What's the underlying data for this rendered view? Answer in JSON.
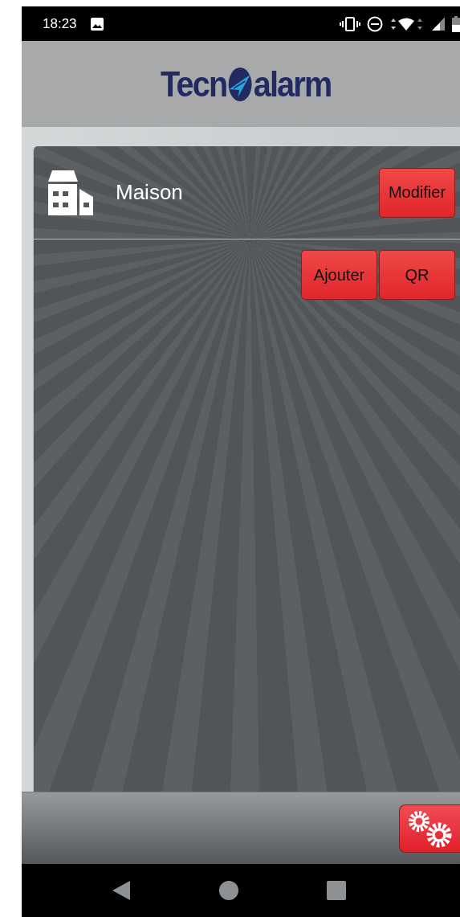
{
  "status_bar": {
    "time": "18:23"
  },
  "header": {
    "logo_left": "Tecn",
    "logo_right": "alarm"
  },
  "sites": [
    {
      "name": "Maison",
      "button": "Modifier"
    }
  ],
  "actions": [
    "Ajouter",
    "QR"
  ]
}
